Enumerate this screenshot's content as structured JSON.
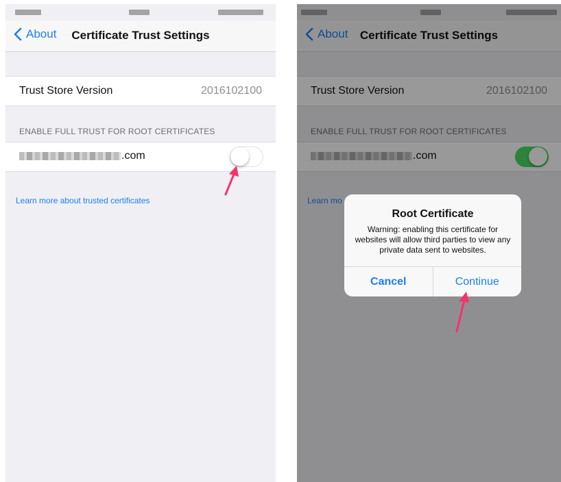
{
  "left_screen": {
    "nav": {
      "back_label": "About",
      "title": "Certificate Trust Settings"
    },
    "trust_store": {
      "label": "Trust Store Version",
      "value": "2016102100"
    },
    "section_header": "ENABLE FULL TRUST FOR ROOT CERTIFICATES",
    "certificate": {
      "domain_suffix": ".com",
      "enabled": false
    },
    "learn_more": "Learn more about trusted certificates"
  },
  "right_screen": {
    "nav": {
      "back_label": "About",
      "title": "Certificate Trust Settings"
    },
    "trust_store": {
      "label": "Trust Store Version",
      "value": "2016102100"
    },
    "section_header": "ENABLE FULL TRUST FOR ROOT CERTIFICATES",
    "certificate": {
      "domain_suffix": ".com",
      "enabled": true
    },
    "learn_more_partial": "Learn mo",
    "alert": {
      "title": "Root Certificate",
      "message": "Warning: enabling this certificate for websites will allow third parties to view any private data sent to websites.",
      "cancel_label": "Cancel",
      "continue_label": "Continue"
    }
  },
  "colors": {
    "accent_blue": "#1b7ff6",
    "toggle_on": "#4cd964",
    "annotation_arrow": "#f5336b"
  }
}
